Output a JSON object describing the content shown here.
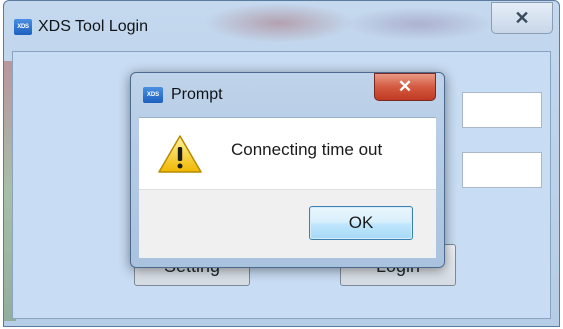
{
  "window": {
    "title": "XDS Tool Login",
    "icon_text": "XDS",
    "close_glyph": "✕",
    "buttons": {
      "setting_label": "Setting",
      "login_label": "Login"
    }
  },
  "dialog": {
    "title": "Prompt",
    "icon_text": "XDS",
    "close_glyph": "✕",
    "message": "Connecting time out",
    "ok_label": "OK",
    "icon": "warning-icon"
  },
  "colors": {
    "close_red": "#c83a22",
    "ok_blue": "#bee6fd",
    "window_frame": "#b6cde6",
    "warning_yellow": "#f2c200"
  }
}
